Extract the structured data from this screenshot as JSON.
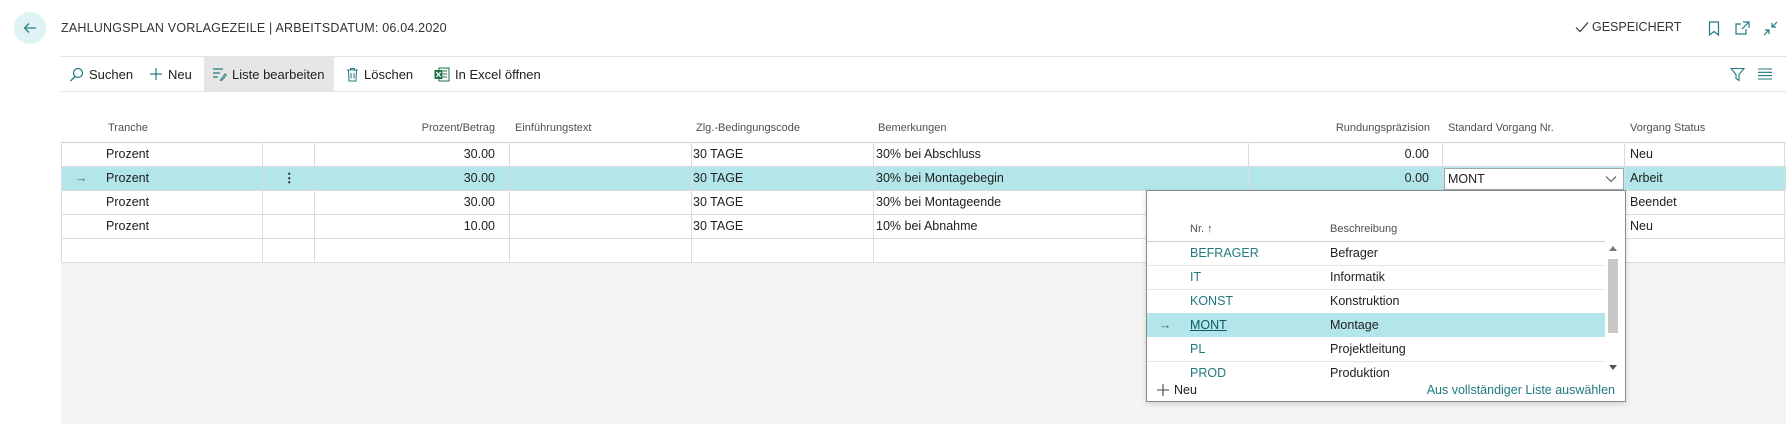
{
  "header": {
    "title": "ZAHLUNGSPLAN VORLAGEZEILE | ARBEITSDATUM: 06.04.2020",
    "saved_status": "GESPEICHERT",
    "icons": [
      "back-arrow-icon",
      "bookmark-icon",
      "open-new-window-icon",
      "collapse-icon"
    ]
  },
  "toolbar": {
    "search": "Suchen",
    "new": "Neu",
    "edit_list": "Liste bearbeiten",
    "delete": "Löschen",
    "open_excel": "In Excel öffnen",
    "icons": [
      "search-icon",
      "plus-icon",
      "edit-list-icon",
      "trash-icon",
      "excel-icon",
      "filter-icon",
      "list-view-icon"
    ]
  },
  "table": {
    "columns": [
      "Tranche",
      "Prozent/Betrag",
      "Einführungstext",
      "Zlg.-Bedingungscode",
      "Bemerkungen",
      "Rundungspräzision",
      "Standard Vorgang Nr.",
      "Vorgang Status"
    ],
    "rows": [
      {
        "tranche": "Prozent",
        "amount": "30.00",
        "intro": "",
        "code": "30 TAGE",
        "remark": "30% bei Abschluss",
        "rounding": "0.00",
        "standard": "",
        "status": "Neu"
      },
      {
        "tranche": "Prozent",
        "amount": "30.00",
        "intro": "",
        "code": "30 TAGE",
        "remark": "30% bei Montagebegin",
        "rounding": "0.00",
        "standard": "MONT",
        "status": "Arbeit"
      },
      {
        "tranche": "Prozent",
        "amount": "30.00",
        "intro": "",
        "code": "30 TAGE",
        "remark": "30% bei Montageende",
        "rounding": "",
        "standard": "",
        "status": "Beendet"
      },
      {
        "tranche": "Prozent",
        "amount": "10.00",
        "intro": "",
        "code": "30 TAGE",
        "remark": "10% bei Abnahme",
        "rounding": "",
        "standard": "",
        "status": "Neu"
      }
    ]
  },
  "lookup": {
    "col_code": "Nr. ↑",
    "col_desc": "Beschreibung",
    "items": [
      {
        "code": "BEFRAGER",
        "desc": "Befrager"
      },
      {
        "code": "IT",
        "desc": "Informatik"
      },
      {
        "code": "KONST",
        "desc": "Konstruktion"
      },
      {
        "code": "MONT",
        "desc": "Montage"
      },
      {
        "code": "PL",
        "desc": "Projektleitung"
      },
      {
        "code": "PROD",
        "desc": "Produktion"
      }
    ],
    "new": "Neu",
    "full_list": "Aus vollständiger Liste auswählen"
  },
  "colors": {
    "accent": "#217a80",
    "selected_row": "#b3e6ea",
    "back_button": "#dff3f4"
  }
}
